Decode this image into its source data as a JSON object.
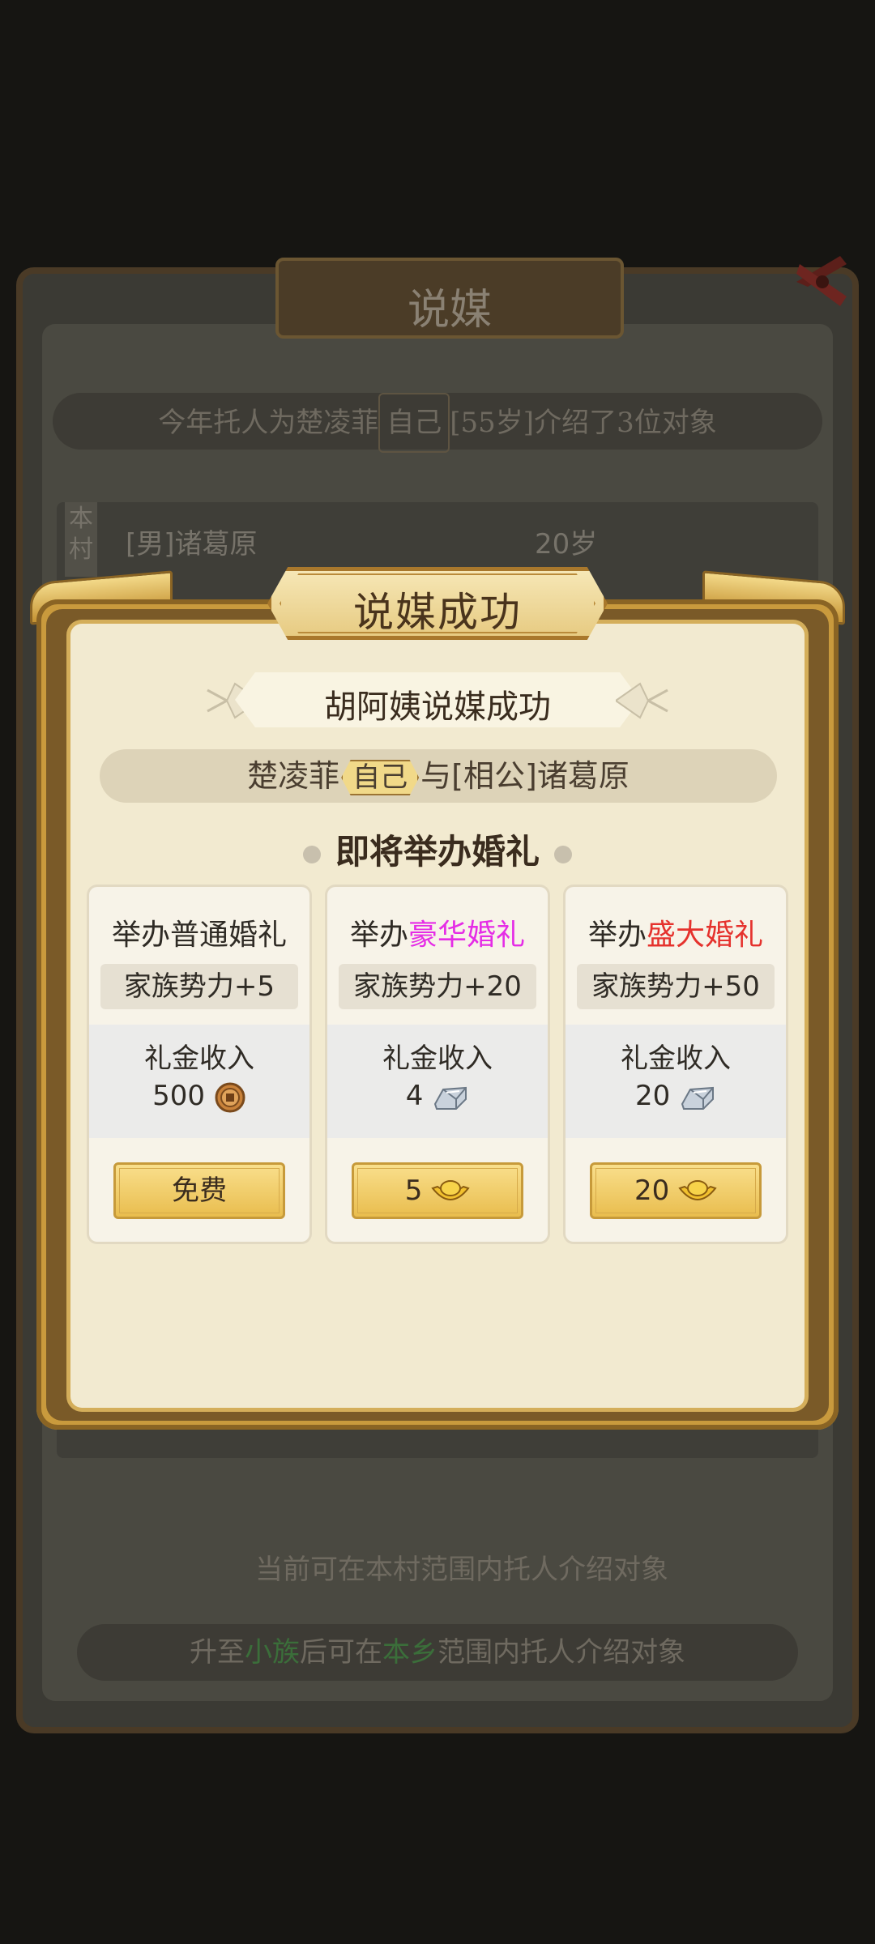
{
  "background": {
    "title": "说媒",
    "intro_prefix": "今年托人为楚凌菲",
    "intro_self": "自己",
    "intro_suffix": "[55岁]介绍了3位对象",
    "row_tag": "本村",
    "row_name": "[男]诸葛原",
    "row_age": "20岁",
    "info_current": "当前可在本村范围内托人介绍对象",
    "info_upgrade_a": "升至",
    "info_upgrade_b": "小族",
    "info_upgrade_c": "后可在",
    "info_upgrade_d": "本乡",
    "info_upgrade_e": "范围内托人介绍对象"
  },
  "popup": {
    "title": "说媒成功",
    "subtitle": "胡阿姨说媒成功",
    "names_a": "楚凌菲",
    "names_self": "自己",
    "names_b": "与[相公]诸葛原",
    "heading": "即将举办婚礼",
    "cards": [
      {
        "title_a": "举办普通婚礼",
        "title_b": "",
        "power": "家族势力+5",
        "income_label": "礼金收入",
        "income_value": "500",
        "income_icon": "copper-coin-icon",
        "button": "免费"
      },
      {
        "title_a": "举办",
        "title_b": "豪华婚礼",
        "power": "家族势力+20",
        "income_label": "礼金收入",
        "income_value": "4",
        "income_icon": "silver-ingot-icon",
        "button": "5",
        "button_icon": "gold-ingot-icon"
      },
      {
        "title_a": "举办",
        "title_b": "盛大婚礼",
        "power": "家族势力+50",
        "income_label": "礼金收入",
        "income_value": "20",
        "income_icon": "silver-ingot-icon",
        "button": "20",
        "button_icon": "gold-ingot-icon"
      }
    ]
  },
  "colors": {
    "accent_gold": "#e9bd4e",
    "luxury": "#e52ce6",
    "grand": "#e5322d",
    "clan_green": "#3b6e3a"
  }
}
